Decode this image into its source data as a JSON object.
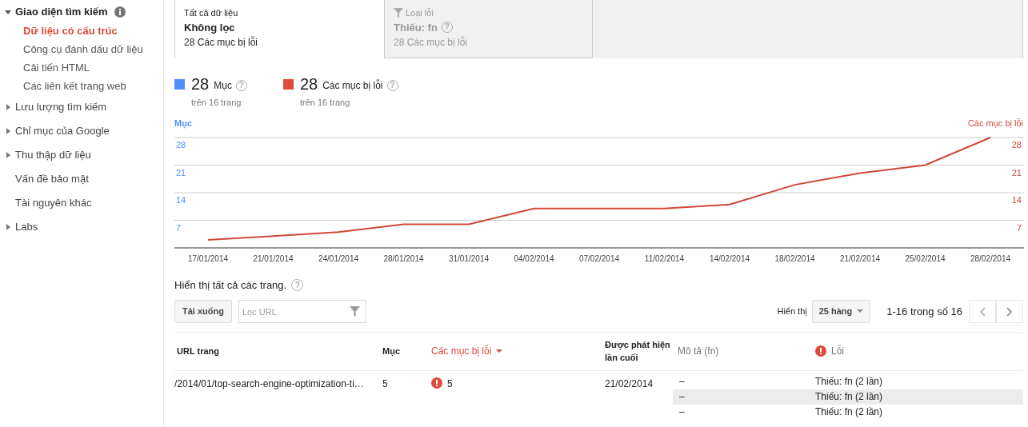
{
  "sidebar": {
    "items": [
      {
        "label": "Giao diện tìm kiếm",
        "expandable": true,
        "expanded": true,
        "info": true,
        "children": [
          {
            "label": "Dữ liệu có cấu trúc",
            "selected": true
          },
          {
            "label": "Công cụ đánh dấu dữ liệu",
            "selected": false
          },
          {
            "label": "Cải tiến HTML",
            "selected": false
          },
          {
            "label": "Các liên kết trang web",
            "selected": false
          }
        ]
      },
      {
        "label": "Lưu lượng tìm kiếm",
        "expandable": true,
        "expanded": false
      },
      {
        "label": "Chỉ mục của Google",
        "expandable": true,
        "expanded": false
      },
      {
        "label": "Thu thập dữ liệu",
        "expandable": true,
        "expanded": false
      },
      {
        "label": "Vấn đề bảo mật",
        "expandable": false
      },
      {
        "label": "Tài nguyên khác",
        "expandable": false
      },
      {
        "label": "Labs",
        "expandable": true,
        "expanded": false
      }
    ]
  },
  "filter_tabs": [
    {
      "caption": "Tất cả dữ liệu",
      "title": "Không lọc",
      "count": "28 Các mục bị lỗi",
      "selected": true,
      "filter_icon": false
    },
    {
      "caption": "Loại lỗi",
      "title": "Thiếu: fn",
      "help": "?",
      "count": "28 Các mục bị lỗi",
      "selected": false,
      "filter_icon": true
    }
  ],
  "legend": [
    {
      "value": "28",
      "label": "Mục",
      "help": "?",
      "sub": "trên 16 trang",
      "color": "#4d90fe"
    },
    {
      "value": "28",
      "label": "Các mục bị lỗi",
      "help": "?",
      "sub": "trên 16 trang",
      "color": "#dd4b39"
    }
  ],
  "chart": {
    "chart_data": {
      "type": "line",
      "ylabel": "Mục",
      "grid": true,
      "categories": [
        "17/01/2014",
        "21/01/2014",
        "24/01/2014",
        "28/01/2014",
        "31/01/2014",
        "04/02/2014",
        "07/02/2014",
        "11/02/2014",
        "14/02/2014",
        "18/02/2014",
        "21/02/2014",
        "25/02/2014",
        "28/02/2014"
      ],
      "series": [
        {
          "name": "Các mục bị lỗi",
          "color": "#d14836",
          "values": [
            2,
            3,
            4,
            6,
            6,
            10,
            10,
            10,
            11,
            16,
            19,
            21,
            28
          ]
        }
      ],
      "ylim": [
        0,
        28
      ],
      "yticks": [
        {
          "value": 7,
          "label": "7"
        },
        {
          "value": 14,
          "label": "14"
        },
        {
          "value": 21,
          "label": "21"
        },
        {
          "value": 28,
          "label": "28"
        }
      ]
    }
  },
  "table_toolbar": {
    "title": "Hiển thị tất cả các trang.",
    "help": "?",
    "download": "Tải xuống",
    "filter_placeholder": "Lọc URL",
    "rows_label": "Hiển thị",
    "rows_value": "25 hàng",
    "range": "1-16 trong số 16"
  },
  "table": {
    "columns": [
      {
        "label": "URL trang",
        "sorted": false
      },
      {
        "label": "Mục",
        "sorted": false
      },
      {
        "label": "Các mục bị lỗi",
        "sorted": true
      },
      {
        "label": "Được phát hiện lần cuối",
        "sorted": false
      }
    ],
    "rows": [
      {
        "url": "/2014/01/top-search-engine-optimization-ti…",
        "items": "5",
        "errors": "5",
        "last_seen": "21/02/2014"
      }
    ]
  },
  "detail": {
    "columns": [
      "Mô tả (fn)",
      "Lỗi"
    ],
    "rows": [
      {
        "description": "–",
        "error": "Thiếu: fn (2 lần)"
      },
      {
        "description": "–",
        "error": "Thiếu: fn (2 lần)"
      },
      {
        "description": "–",
        "error": "Thiếu: fn (2 lần)"
      }
    ]
  }
}
